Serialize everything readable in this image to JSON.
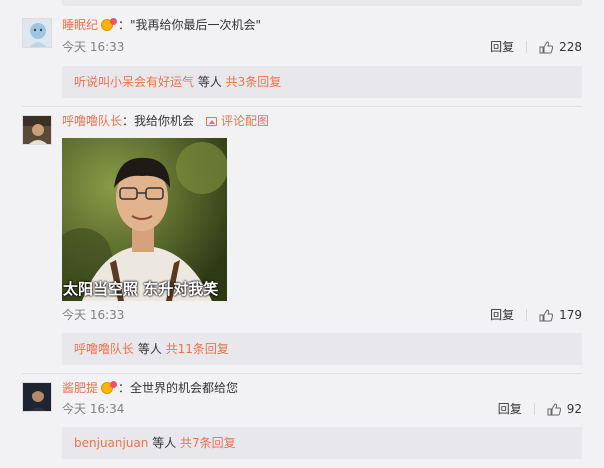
{
  "comments": [
    {
      "username": "睡眠纪",
      "text": "\"我再给你最后一次机会\"",
      "time": "今天 16:33",
      "reply_label": "回复",
      "likes": "228",
      "replies": {
        "users": "听说叫小呆会有好运气",
        "suffix": " 等人 ",
        "count_text": "共3条回复"
      }
    },
    {
      "username": "呼噜噜队长",
      "text": "我给你机会",
      "pic_link": "评论配图",
      "image_caption": "太阳当空照 东升对我笑",
      "time": "今天 16:33",
      "reply_label": "回复",
      "likes": "179",
      "replies": {
        "users": "呼噜噜队长",
        "suffix": " 等人 ",
        "count_text": "共11条回复"
      }
    },
    {
      "username": "酱肥提",
      "text": "全世界的机会都给您",
      "time": "今天 16:34",
      "reply_label": "回复",
      "likes": "92",
      "replies": {
        "users": "benjuanjuan",
        "suffix": " 等人 ",
        "count_text": "共7条回复"
      }
    }
  ],
  "colors": {
    "username": "#eb7350",
    "background": "#f2f2f5",
    "reply_box": "#e8e8ec",
    "meta": "#808080"
  },
  "icons": [
    "vip-badge-icon",
    "picture-icon",
    "thumbs-up-icon"
  ]
}
